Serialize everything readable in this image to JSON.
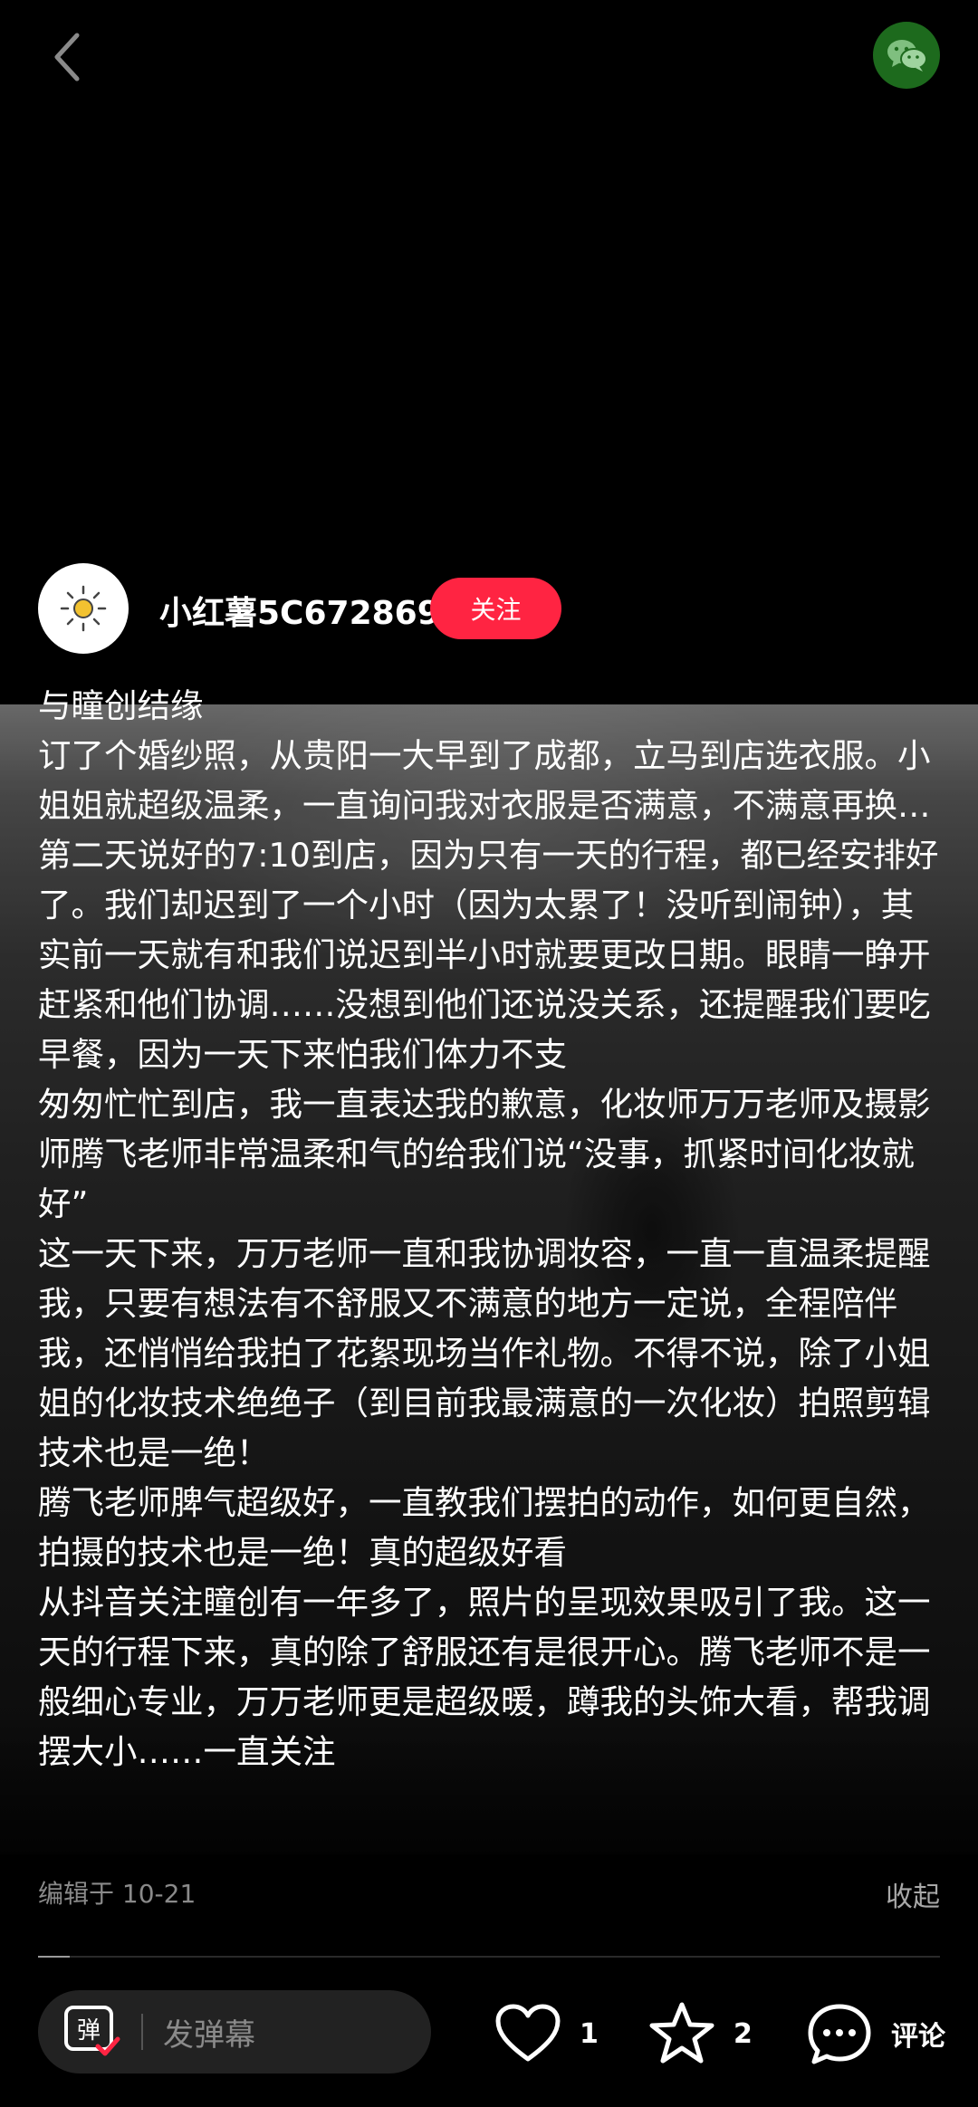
{
  "author": {
    "name": "小红薯5C672869",
    "follow_label": "关注"
  },
  "post": {
    "title": "与瞳创结缘",
    "paragraphs": [
      "订了个婚纱照，从贵阳一大早到了成都，立马到店选衣服。小姐姐就超级温柔，一直询问我对衣服是否满意，不满意再换…",
      "第二天说好的7:10到店，因为只有一天的行程，都已经安排好了。我们却迟到了一个小时（因为太累了！没听到闹钟），其实前一天就有和我们说迟到半小时就要更改日期。眼睛一睁开赶紧和他们协调……没想到他们还说没关系，还提醒我们要吃早餐，因为一天下来怕我们体力不支",
      "匆匆忙忙到店，我一直表达我的歉意，化妆师万万老师及摄影师腾飞老师非常温柔和气的给我们说“没事，抓紧时间化妆就好”",
      "这一天下来，万万老师一直和我协调妆容，一直一直温柔提醒我，只要有想法有不舒服又不满意的地方一定说，全程陪伴我，还悄悄给我拍了花絮现场当作礼物。不得不说，除了小姐姐的化妆技术绝绝子（到目前我最满意的一次化妆）拍照剪辑技术也是一绝！",
      "腾飞老师脾气超级好，一直教我们摆拍的动作，如何更自然，拍摄的技术也是一绝！真的超级好看",
      "从抖音关注瞳创有一年多了，照片的呈现效果吸引了我。这一天的行程下来，真的除了舒服还有是很开心。腾飞老师不是一般细心专业，万万老师更是超级暖，蹲我的头饰大看，帮我调摆大小……一直关注"
    ],
    "edited": "编辑于 10-21",
    "collapse_label": "收起",
    "progress": 0.035
  },
  "bottom_bar": {
    "danmaku_placeholder": "发弹幕",
    "danmaku_icon_text": "弹",
    "like_count": "1",
    "star_count": "2",
    "comment_label": "评论"
  },
  "colors": {
    "accent": "#ff2442",
    "wechat": "#1d6a1d"
  },
  "icons": [
    "back-icon",
    "wechat-icon",
    "sun-avatar-icon",
    "danmaku-icon",
    "heart-icon",
    "star-icon",
    "comment-icon"
  ]
}
